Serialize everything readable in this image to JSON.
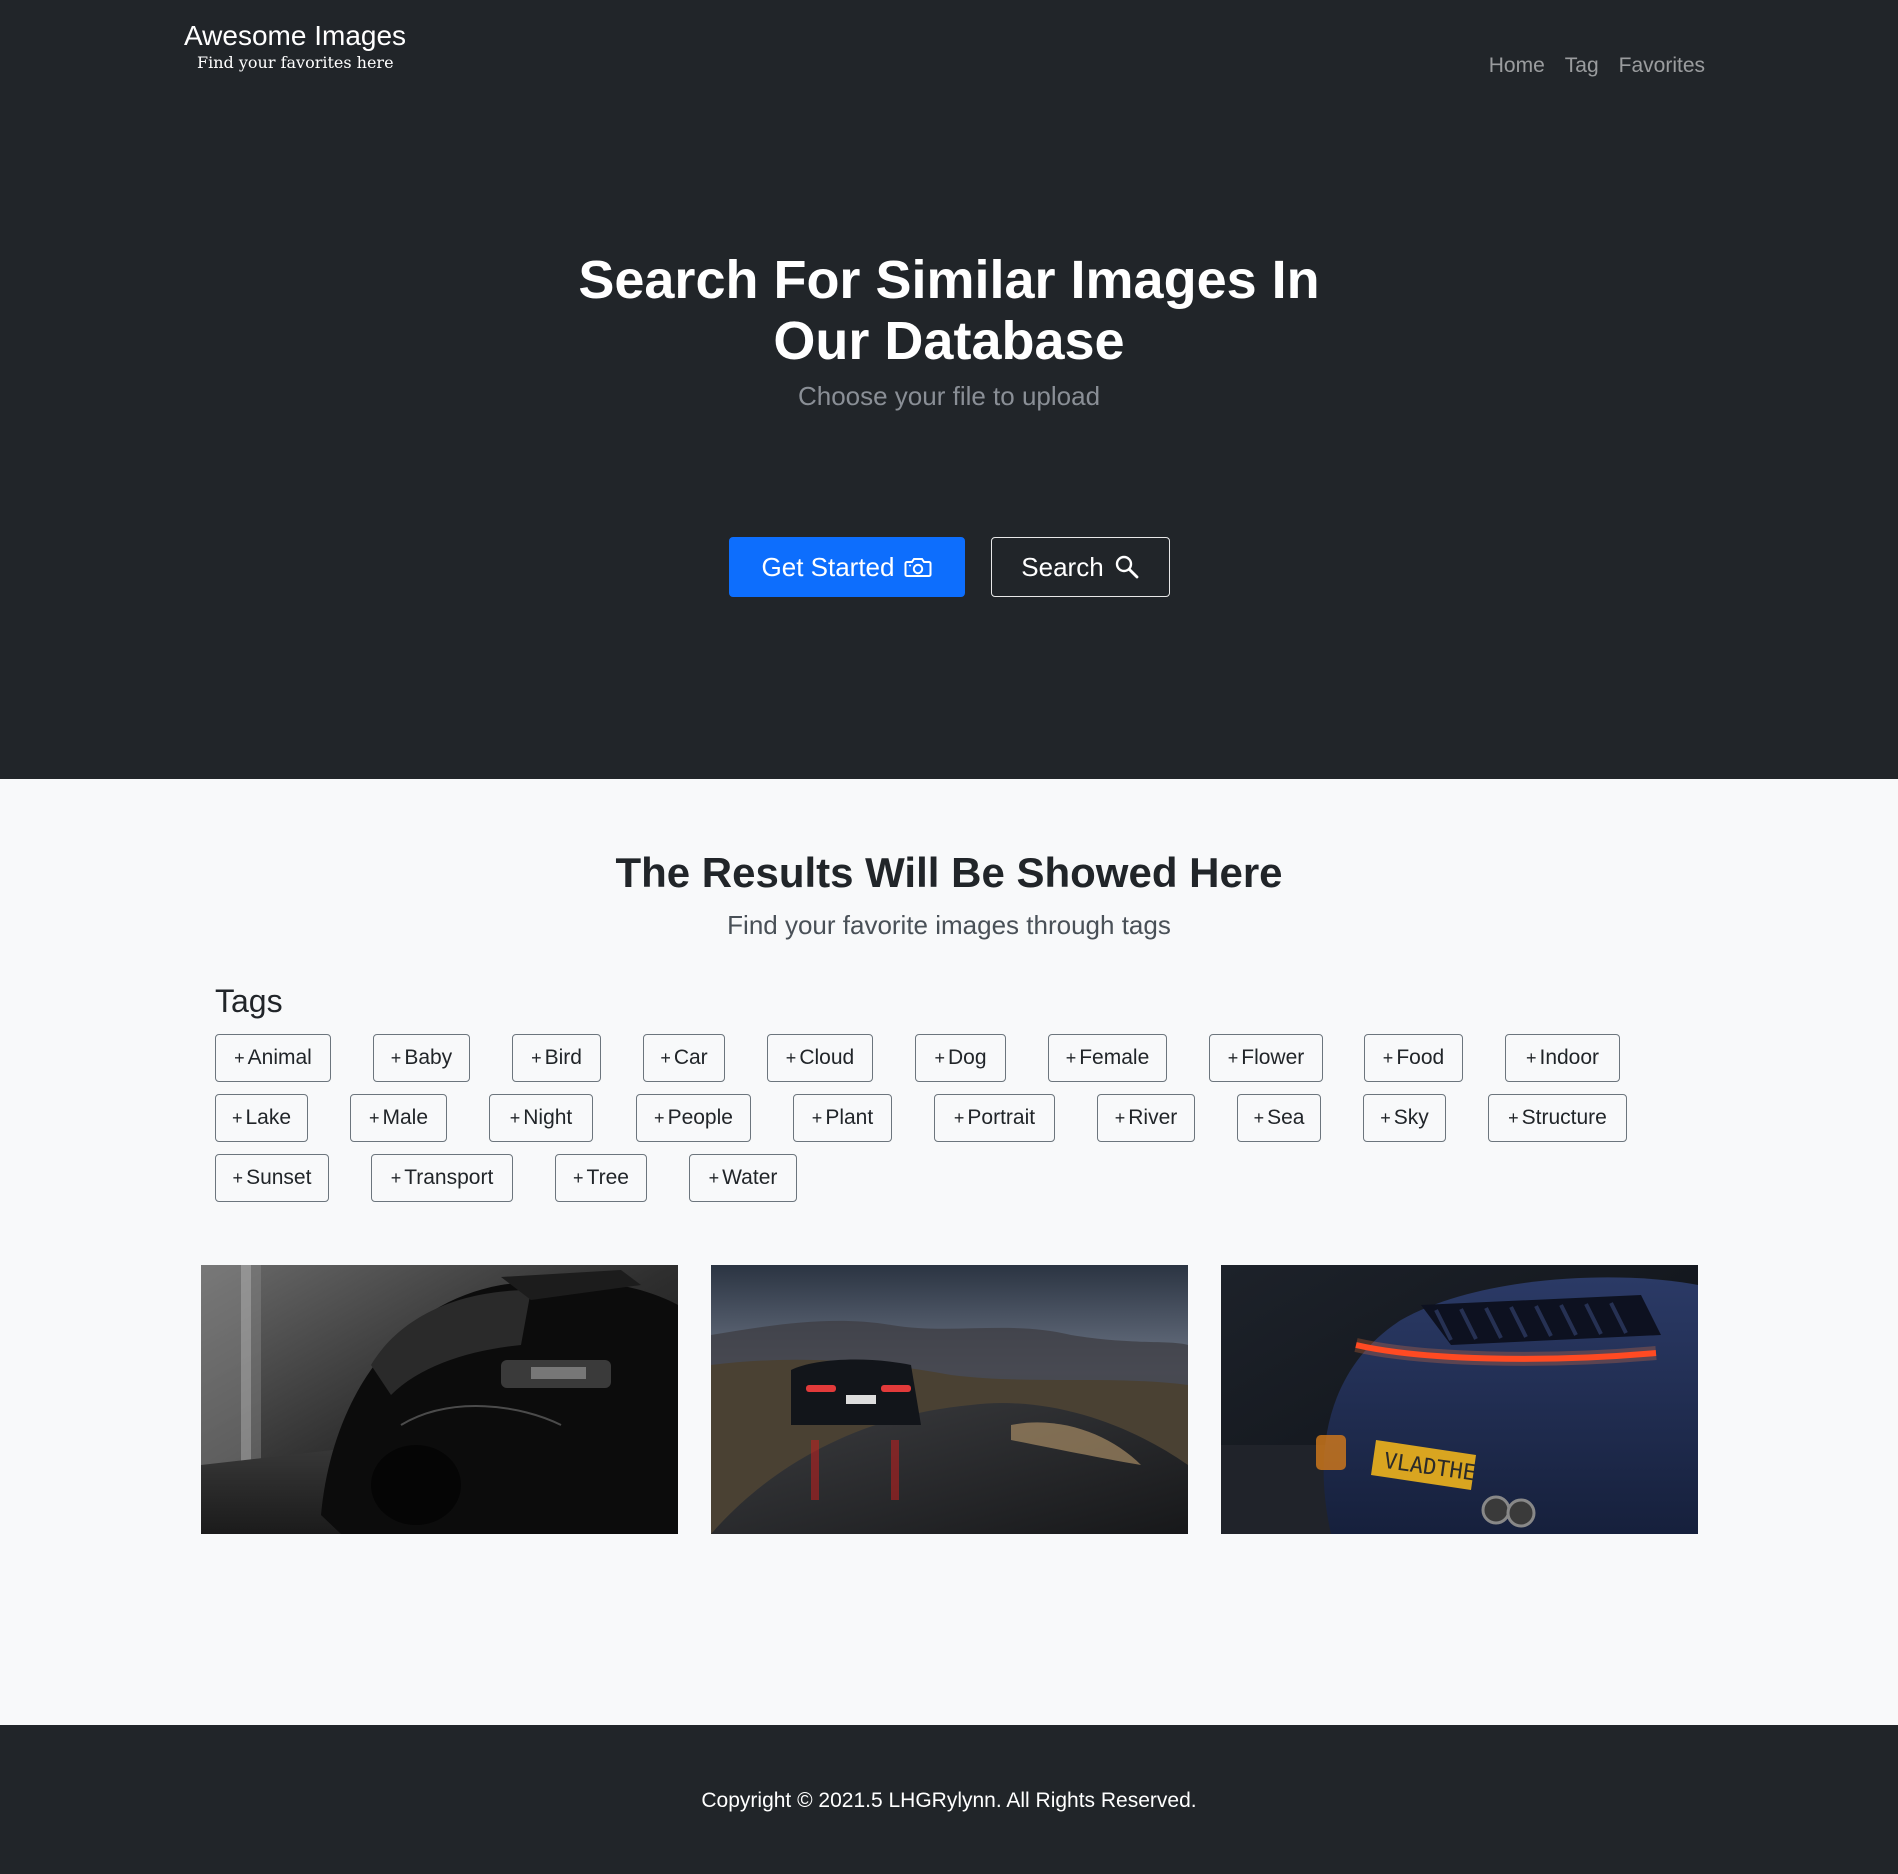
{
  "brand": {
    "title": "Awesome Images",
    "subtitle": "Find your favorites here"
  },
  "nav": {
    "items": [
      "Home",
      "Tag",
      "Favorites"
    ]
  },
  "hero": {
    "heading_line1": "Search For Similar Images In",
    "heading_line2": "Our Database",
    "subheading": "Choose your file to upload",
    "primary_button": "Get Started",
    "primary_icon": "camera-icon",
    "secondary_button": "Search",
    "secondary_icon": "search-icon"
  },
  "results": {
    "heading": "The Results Will Be Showed Here",
    "subheading": "Find your favorite images through tags",
    "tags_title": "Tags",
    "tag_prefix": "+",
    "tags": [
      "Animal",
      "Baby",
      "Bird",
      "Car",
      "Cloud",
      "Dog",
      "Female",
      "Flower",
      "Food",
      "Indoor",
      "Lake",
      "Male",
      "Night",
      "People",
      "Plant",
      "Portrait",
      "River",
      "Sea",
      "Sky",
      "Structure",
      "Sunset",
      "Transport",
      "Tree",
      "Water"
    ],
    "images": [
      {
        "subject": "black-and-white sports car rear view"
      },
      {
        "subject": "sports car driving on mountain road at dusk"
      },
      {
        "subject": "blue sports car rear with light bar at night",
        "plate": "VLADTHE"
      }
    ]
  },
  "footer": {
    "copyright": "Copyright © 2021.5 LHGRylynn. All Rights Reserved."
  },
  "colors": {
    "dark": "#212529",
    "light": "#f8f9fa",
    "primary": "#0d6efd",
    "muted_nav": "#8c8f93"
  }
}
